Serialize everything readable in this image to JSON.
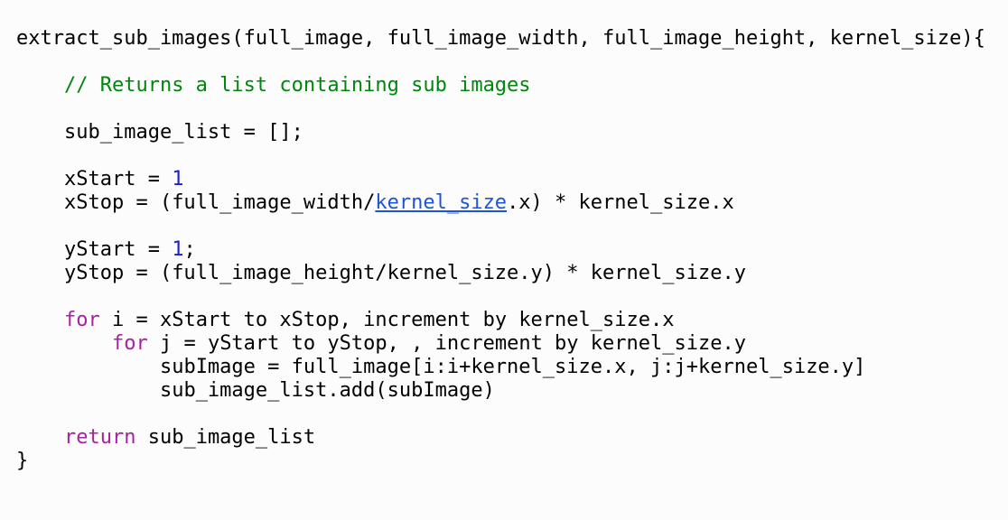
{
  "code": {
    "line_01": "extract_sub_images(full_image, full_image_width, full_image_height, kernel_size){",
    "line_03": "// Returns a list containing sub images",
    "line_05": "sub_image_list = [];",
    "line_07_a": "xStart = ",
    "line_07_num": "1",
    "line_08_a": "xStop = (full_image_width/",
    "line_08_link": "kernel_size",
    "line_08_b": ".x) * kernel_size.x",
    "line_10_a": "yStart = ",
    "line_10_num": "1",
    "line_10_b": ";",
    "line_11": "yStop = (full_image_height/kernel_size.y) * kernel_size.y",
    "line_13_kw": "for",
    "line_13_b": " i = xStart to xStop, increment by kernel_size.x",
    "line_14_kw": "for",
    "line_14_b": " j = yStart to yStop, , increment by kernel_size.y",
    "line_15": "subImage = full_image[i:i+kernel_size.x, j:j+kernel_size.y]",
    "line_16": "sub_image_list.add(subImage)",
    "line_18_kw": "return",
    "line_18_b": " sub_image_list",
    "line_19": "}"
  },
  "colors": {
    "comment": "#00860c",
    "keyword": "#a8219e",
    "number": "#1d1fd1",
    "link": "#1e55d8",
    "text": "#000000",
    "background": "#fcfcfc"
  }
}
